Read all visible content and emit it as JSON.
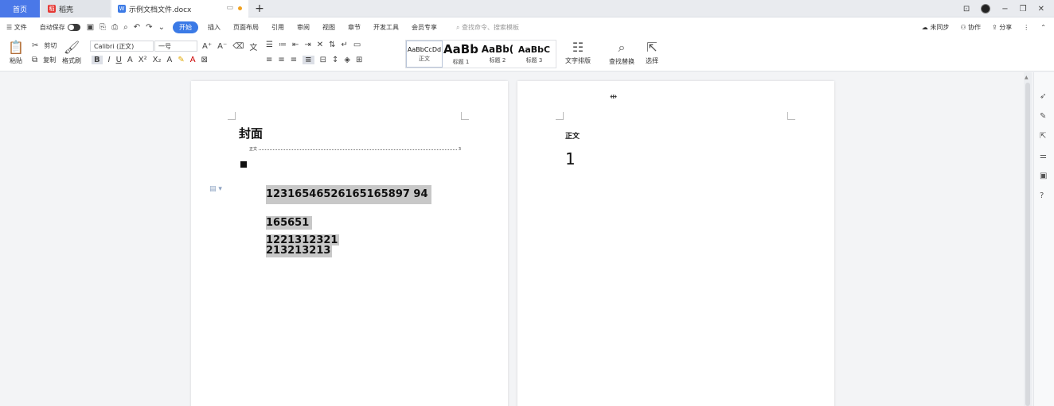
{
  "tabs": {
    "home": "首页",
    "daoke": "稻壳",
    "doc": "示例文档文件.docx",
    "add": "+"
  },
  "window": {
    "layout_icon": "⊡",
    "minimize": "−",
    "restore": "❐",
    "close": "✕"
  },
  "menu": {
    "file": "☰ 文件",
    "autosave": "自动保存",
    "items": [
      "开始",
      "插入",
      "页面布局",
      "引用",
      "审阅",
      "视图",
      "章节",
      "开发工具",
      "会员专享"
    ],
    "search_placeholder": "查找命令、搜索模板",
    "right": {
      "sync": "未同步",
      "collab": "协作",
      "share": "分享"
    }
  },
  "ribbon": {
    "paste": "粘贴",
    "cut": "剪切",
    "copy": "复制",
    "format_painter": "格式刷",
    "font_name": "Calibri (正文)",
    "font_size": "一号",
    "styles": [
      {
        "sample": "AaBbCcDd",
        "caption": "正文"
      },
      {
        "sample": "AaBb",
        "caption": "标题 1"
      },
      {
        "sample": "AaBb(",
        "caption": "标题 2"
      },
      {
        "sample": "AaBbC",
        "caption": "标题 3"
      }
    ],
    "text_layout": "文字排版",
    "find_replace": "查找替换",
    "select": "选择"
  },
  "page1": {
    "title": "封面",
    "toc_label": "正文",
    "toc_page": "3",
    "lines": [
      "12316546526165165897 94",
      "165651",
      "1221312321",
      "213213213"
    ]
  },
  "page2": {
    "label": "正文",
    "number": "1"
  },
  "colors": {
    "accent": "#3b7ae6",
    "home_tab": "#4a78e8",
    "highlight": "#c8c8c8"
  }
}
